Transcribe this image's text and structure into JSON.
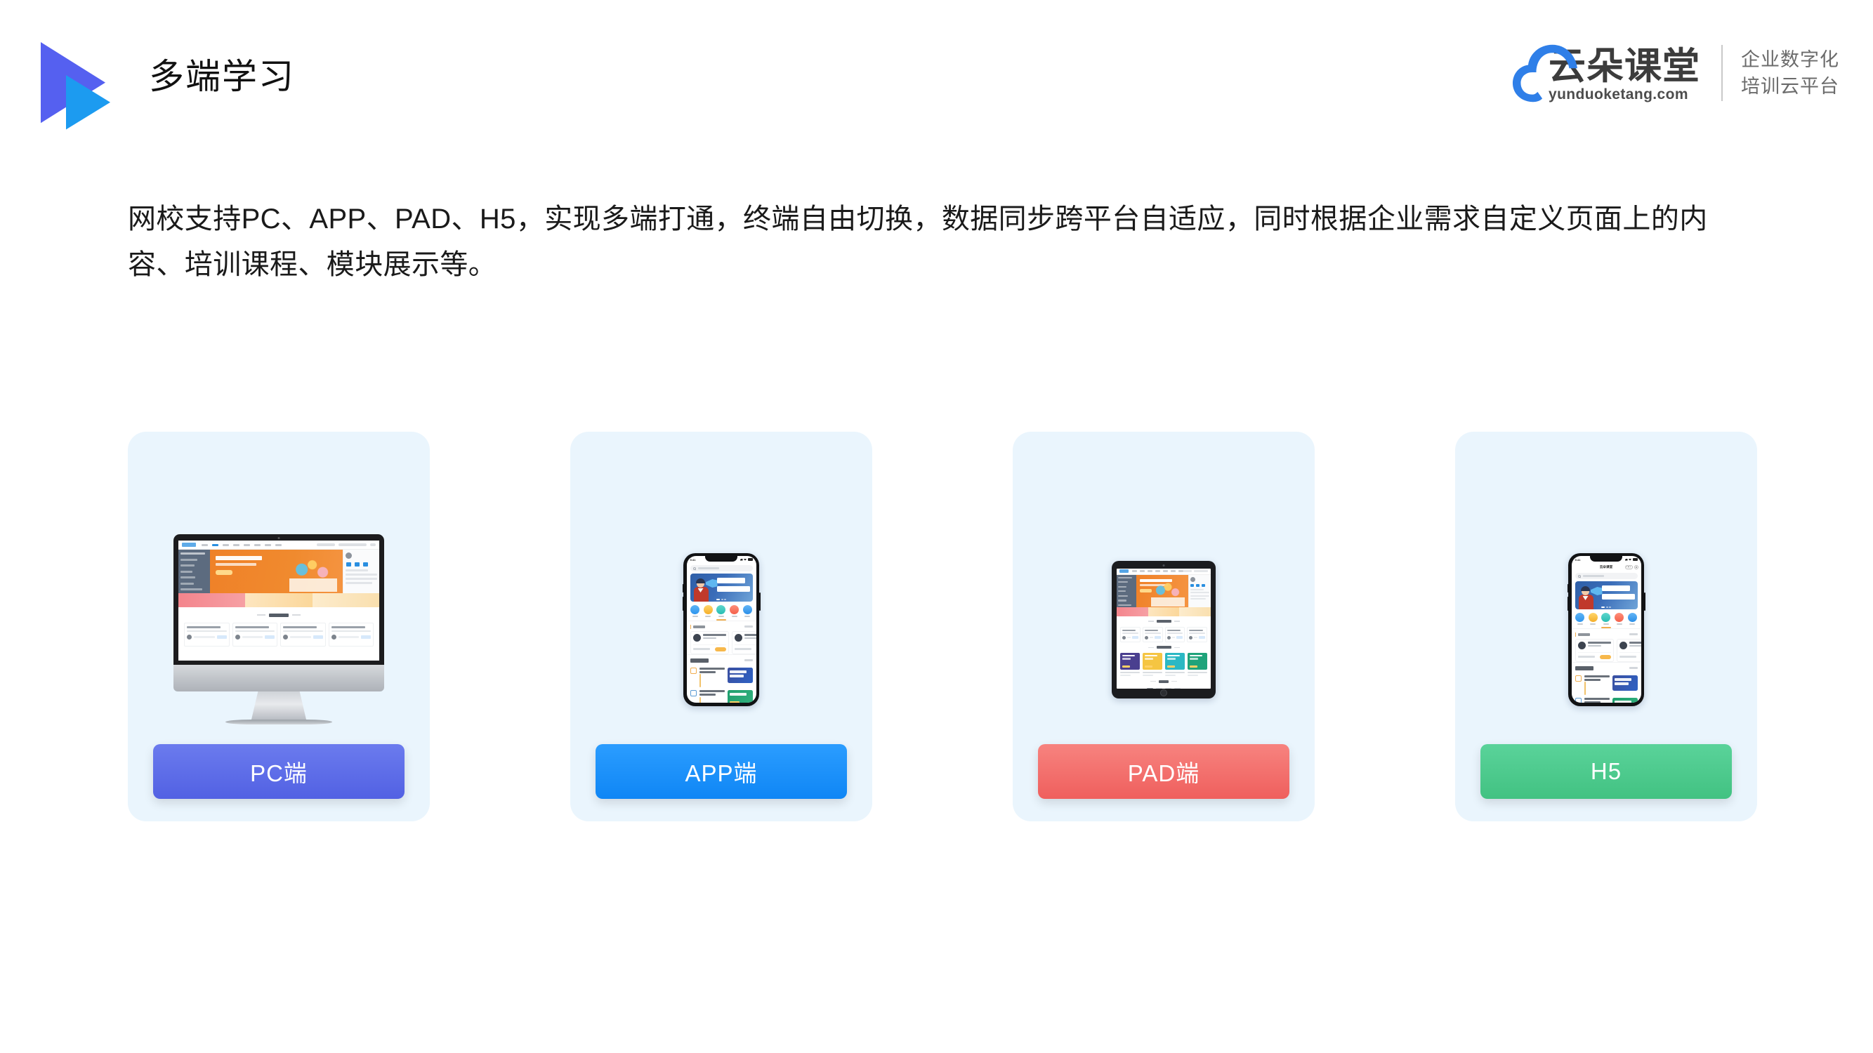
{
  "page": {
    "title": "多端学习",
    "background_color": "#ffffff"
  },
  "header": {
    "title": "多端学习",
    "logo_icon": "play-triangle-icon",
    "logo_colors": {
      "back_triangle": "#5560f0",
      "front_triangle": "#1c9bf0"
    }
  },
  "brand": {
    "cloud_icon": "cloud-icon",
    "cloud_color": "#2f7fe8",
    "name_cn": "云朵课堂",
    "domain": "yunduoketang.com",
    "tagline_line1": "企业数字化",
    "tagline_line2": "培训云平台"
  },
  "intro": {
    "text": "网校支持PC、APP、PAD、H5，实现多端打通，终端自由切换，数据同步跨平台自适应，同时根据企业需求自定义页面上的内容、培训课程、模块展示等。"
  },
  "cards": [
    {
      "key": "pc",
      "device": "desktop-monitor",
      "cta_label": "PC端",
      "cta_color": "#5c6fe8",
      "card_bg": "#eaf5fd",
      "screen": {
        "banner_title": "托福TPO1-54真题及解析",
        "section_title": "公开课",
        "course_count": 4,
        "banner_color": "#ef8128",
        "sidebar_color": "#5c6b7f"
      }
    },
    {
      "key": "app",
      "device": "smartphone",
      "cta_label": "APP端",
      "cta_color": "#1890ff",
      "card_bg": "#eaf5fd",
      "screen": {
        "status_time": "9:41",
        "search_placeholder": "输入关键词搜索",
        "banner_line1": "职场人的",
        "banner_line2": "第一堂沟通课",
        "banner_color": "#2f5fa8",
        "categories": [
          "课程",
          "课程包",
          "问题",
          "直播",
          "资料"
        ],
        "section_open": "公开课",
        "section_more": "更多",
        "section_recommend": "推荐课程",
        "open_course_count": 2,
        "recommend_course_count": 2
      }
    },
    {
      "key": "pad",
      "device": "tablet",
      "cta_label": "PAD端",
      "cta_color": "#f56c6c",
      "card_bg": "#eaf5fd",
      "screen": {
        "banner_title": "托福TPO1-54真题及解析",
        "section_open": "公开课",
        "section_recommend": "推荐课程",
        "section_courses": "课程",
        "open_course_count": 4,
        "recommend_tile_colors": [
          "#4a3f8f",
          "#f5c542",
          "#2bb8c4",
          "#1fa37a"
        ],
        "course_tile_colors": [
          "#2d5f8a",
          "#ef7f3a",
          "#3c4656",
          "#1f8fe0",
          "#f2c245",
          "#2391dc",
          "#1fa37a",
          "#ef7f3a"
        ]
      }
    },
    {
      "key": "h5",
      "device": "smartphone",
      "cta_label": "H5",
      "cta_color": "#4ecb8d",
      "card_bg": "#eaf5fd",
      "screen": {
        "status_time": "9:41",
        "navbar_title": "云朵课堂",
        "search_placeholder": "输入关键词搜索",
        "banner_line1": "职场人的",
        "banner_line2": "第一堂沟通课",
        "banner_color": "#2f5fa8",
        "categories": [
          "课程",
          "课程包",
          "问题",
          "直播",
          "资料"
        ],
        "section_open": "公开课",
        "section_more": "更多",
        "section_recommend": "推荐课程",
        "open_course_count": 2,
        "recommend_course_count": 2
      }
    }
  ]
}
